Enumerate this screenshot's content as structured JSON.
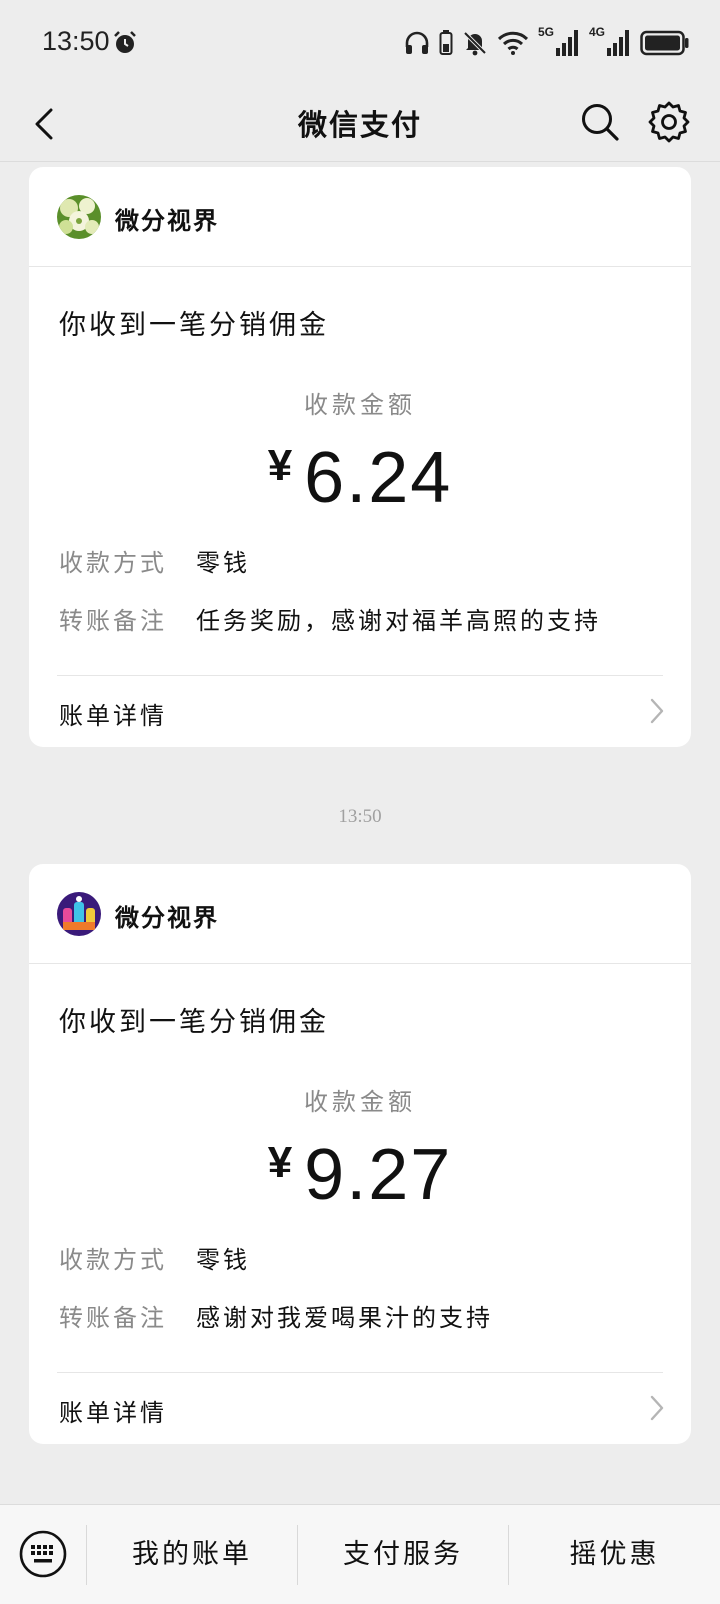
{
  "status_bar": {
    "time": "13:50",
    "icons": [
      "alarm-icon",
      "headphones-icon",
      "battery-small-icon",
      "mute-icon",
      "wifi-icon",
      "signal-5g-icon",
      "signal-4g-icon",
      "battery-icon"
    ],
    "network_5g": "5G",
    "network_4g": "4G"
  },
  "nav": {
    "title": "微信支付",
    "back_icon": "chevron-left-icon",
    "search_icon": "search-icon",
    "settings_icon": "gear-icon"
  },
  "messages": [
    {
      "sender": "微分视界",
      "title": "你收到一笔分销佣金",
      "amount_label": "收款金额",
      "currency": "¥",
      "amount": "6.24",
      "method_key": "收款方式",
      "method_val": "零钱",
      "note_key": "转账备注",
      "note_val": "任务奖励，感谢对福羊高照的支持",
      "details": "账单详情"
    },
    {
      "sender": "微分视界",
      "title": "你收到一笔分销佣金",
      "amount_label": "收款金额",
      "currency": "¥",
      "amount": "9.27",
      "method_key": "收款方式",
      "method_val": "零钱",
      "note_key": "转账备注",
      "note_val": "感谢对我爱喝果汁的支持",
      "details": "账单详情"
    }
  ],
  "timestamp": "13:50",
  "bottom_menu": {
    "keyboard_icon": "keyboard-icon",
    "items": [
      "我的账单",
      "支付服务",
      "摇优惠"
    ]
  }
}
